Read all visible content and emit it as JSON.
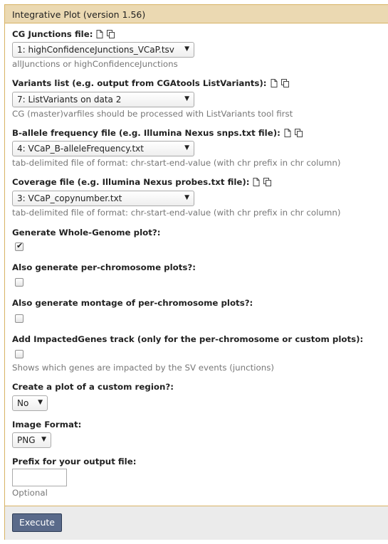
{
  "tool": {
    "title": "Integrative Plot (version 1.56)"
  },
  "fields": {
    "junctions": {
      "label": "CG Junctions file:",
      "value": "1: highConfidenceJunctions_VCaP.tsv",
      "help": "allJunctions or highConfidenceJunctions"
    },
    "variants": {
      "label": "Variants list (e.g. output from CGAtools ListVariants):",
      "value": "7: ListVariants on data 2",
      "help": "CG (master)varfiles should be processed with ListVariants tool first"
    },
    "ballele": {
      "label": "B-allele frequency file (e.g. Illumina Nexus snps.txt file):",
      "value": "4: VCaP_B-alleleFrequency.txt",
      "help": "tab-delimited file of format: chr-start-end-value (with chr prefix in chr column)"
    },
    "coverage": {
      "label": "Coverage file (e.g. Illumina Nexus probes.txt file):",
      "value": "3: VCaP_copynumber.txt",
      "help": "tab-delimited file of format: chr-start-end-value (with chr prefix in chr column)"
    },
    "whole_genome": {
      "label": "Generate Whole-Genome plot?:",
      "checked": true
    },
    "per_chromosome": {
      "label": "Also generate per-chromosome plots?:",
      "checked": false
    },
    "montage": {
      "label": "Also generate montage of per-chromosome plots?:",
      "checked": false
    },
    "impacted_genes": {
      "label": "Add ImpactedGenes track (only for the per-chromosome or custom plots):",
      "checked": false,
      "help": "Shows which genes are impacted by the SV events (junctions)"
    },
    "custom_region": {
      "label": "Create a plot of a custom region?:",
      "value": "No"
    },
    "image_format": {
      "label": "Image Format:",
      "value": "PNG"
    },
    "prefix": {
      "label": "Prefix for your output file:",
      "value": "",
      "help": "Optional"
    }
  },
  "actions": {
    "execute_label": "Execute"
  },
  "icons": {
    "file": "file-icon",
    "copy": "copy-icon",
    "checkmark": "✔",
    "dropdown": "▼"
  }
}
